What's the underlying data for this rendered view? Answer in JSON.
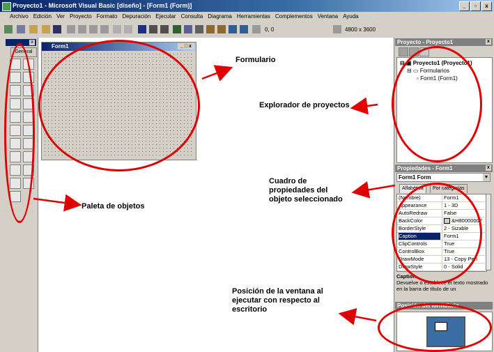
{
  "window": {
    "title": "Proyecto1 - Microsoft Visual Basic [diseño] - [Form1 (Form)]",
    "buttons": [
      "_",
      "▫",
      "x"
    ]
  },
  "menubar": {
    "items": [
      "Archivo",
      "Edición",
      "Ver",
      "Proyecto",
      "Formato",
      "Depuración",
      "Ejecutar",
      "Consulta",
      "Diagrama",
      "Herramientas",
      "Complementos",
      "Ventana",
      "Ayuda"
    ]
  },
  "toolbar": {
    "position": "0, 0",
    "size": "4800 x 3600"
  },
  "toolbox": {
    "tab": "General"
  },
  "form_window": {
    "title": "Form1"
  },
  "project_explorer": {
    "title": "Proyecto - Proyecto1",
    "root": "Proyecto1 (Proyecto1)",
    "folder": "Formularios",
    "item": "Form1 (Form1)"
  },
  "properties": {
    "title": "Propiedades - Form1",
    "object": "Form1 Form",
    "tabs": [
      "Alfabética",
      "Por categorías"
    ],
    "rows": [
      {
        "name": "(Nombre)",
        "value": "Form1"
      },
      {
        "name": "Appearance",
        "value": "1 - 3D"
      },
      {
        "name": "AutoRedraw",
        "value": "False"
      },
      {
        "name": "BackColor",
        "value": "&H8000000F"
      },
      {
        "name": "BorderStyle",
        "value": "2 - Sizable"
      },
      {
        "name": "Caption",
        "value": "Form1"
      },
      {
        "name": "ClipControls",
        "value": "True"
      },
      {
        "name": "ControlBox",
        "value": "True"
      },
      {
        "name": "DrawMode",
        "value": "13 - Copy Pen"
      },
      {
        "name": "DrawStyle",
        "value": "0 - Solid"
      }
    ],
    "desc_title": "Caption",
    "desc_text": "Devuelve o establece el texto mostrado en la barra de título de un"
  },
  "form_layout": {
    "title": "Posición del formulario"
  },
  "annotations": {
    "formulario": "Formulario",
    "explorador": "Explorador de proyectos",
    "cuadro": "Cuadro de propiedades del objeto seleccionado",
    "paleta": "Paleta de objetos",
    "posicion": "Posición de la ventana al ejecutar con respecto al escritorio"
  },
  "colors": {
    "annotation_red": "#e00000",
    "titlebar_blue": "#0a246a",
    "chrome_gray": "#d4d0c8"
  }
}
